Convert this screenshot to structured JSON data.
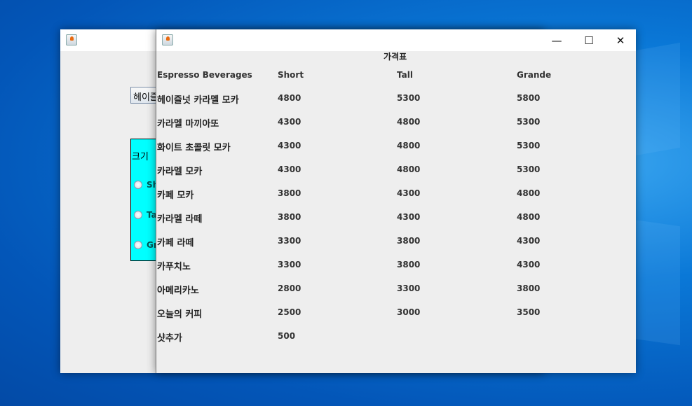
{
  "back_window": {
    "combo_value": "헤이즐넛 카라멜 모카",
    "size_label": "크기",
    "radio_options": [
      "Short",
      "Tall",
      "Grande"
    ]
  },
  "front_window": {
    "controls": {
      "minimize": "—",
      "maximize": "☐",
      "close": "✕"
    },
    "title": "가격표",
    "headers": [
      "Espresso Beverages",
      "Short",
      "Tall",
      "Grande"
    ],
    "rows": [
      [
        "헤이즐넛 카라멜 모카",
        "4800",
        "5300",
        "5800"
      ],
      [
        "카라멜 마끼아또",
        "4300",
        "4800",
        "5300"
      ],
      [
        "화이트 초콜릿 모카",
        "4300",
        "4800",
        "5300"
      ],
      [
        "카라멜 모카",
        "4300",
        "4800",
        "5300"
      ],
      [
        "카페 모카",
        "3800",
        "4300",
        "4800"
      ],
      [
        "카라멜 라떼",
        "3800",
        "4300",
        "4800"
      ],
      [
        "카페 라떼",
        "3300",
        "3800",
        "4300"
      ],
      [
        "카푸치노",
        "3300",
        "3800",
        "4300"
      ],
      [
        "아메리카노",
        "2800",
        "3300",
        "3800"
      ],
      [
        "오늘의 커피",
        "2500",
        "3000",
        "3500"
      ],
      [
        "샷추가",
        "500",
        "",
        ""
      ]
    ]
  }
}
